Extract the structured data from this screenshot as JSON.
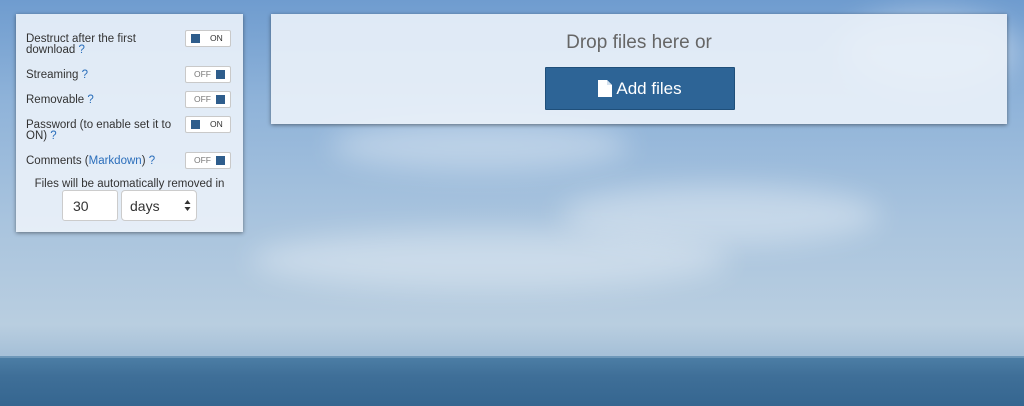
{
  "options": {
    "destruct": {
      "label": "Destruct after the first download",
      "help": "?",
      "toggle": "ON"
    },
    "streaming": {
      "label": "Streaming",
      "help": "?",
      "toggle": "OFF"
    },
    "removable": {
      "label": "Removable",
      "help": "?",
      "toggle": "OFF"
    },
    "password": {
      "label": "Password (to enable set it to ON)",
      "help": "?",
      "toggle": "ON"
    },
    "comments": {
      "label_before": "Comments (",
      "link": "Markdown",
      "label_after": ")",
      "help": "?",
      "toggle": "OFF"
    },
    "expiration": {
      "text": "Files will be automatically removed in",
      "value": "30",
      "unit": "days"
    }
  },
  "dropzone": {
    "text": "Drop files here or",
    "button_label": "Add files"
  },
  "icons": {
    "add_files": "file-icon",
    "select": "chevron-up-down-icon"
  },
  "colors": {
    "button": "#2d6496",
    "toggle_square": "#2e5d8c",
    "help_link": "#2a6ebb"
  }
}
